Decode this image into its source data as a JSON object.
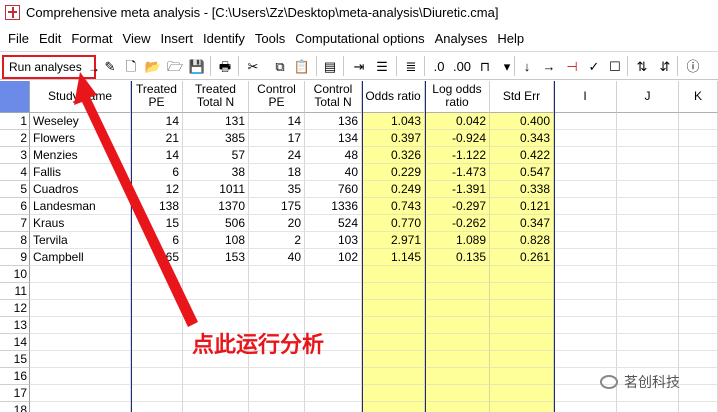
{
  "window": {
    "title": "Comprehensive meta analysis - [C:\\Users\\Zz\\Desktop\\meta-analysis\\Diuretic.cma]"
  },
  "menu": [
    "File",
    "Edit",
    "Format",
    "View",
    "Insert",
    "Identify",
    "Tools",
    "Computational options",
    "Analyses",
    "Help"
  ],
  "toolbar": {
    "run_label": "Run analyses",
    "run_arrow": "→"
  },
  "columns": {
    "study": "Study name",
    "treated_pe": "Treated\nPE",
    "treated_n": "Treated\nTotal N",
    "control_pe": "Control\nPE",
    "control_n": "Control\nTotal N",
    "odds_ratio": "Odds ratio",
    "log_odds": "Log odds\nratio",
    "std_err": "Std Err",
    "col_i": "I",
    "col_j": "J",
    "col_k": "K"
  },
  "rows": [
    {
      "n": "1",
      "study": "Weseley",
      "tpe": "14",
      "tn": "131",
      "cpe": "14",
      "cn": "136",
      "or": "1.043",
      "lor": "0.042",
      "se": "0.400"
    },
    {
      "n": "2",
      "study": "Flowers",
      "tpe": "21",
      "tn": "385",
      "cpe": "17",
      "cn": "134",
      "or": "0.397",
      "lor": "-0.924",
      "se": "0.343"
    },
    {
      "n": "3",
      "study": "Menzies",
      "tpe": "14",
      "tn": "57",
      "cpe": "24",
      "cn": "48",
      "or": "0.326",
      "lor": "-1.122",
      "se": "0.422"
    },
    {
      "n": "4",
      "study": "Fallis",
      "tpe": "6",
      "tn": "38",
      "cpe": "18",
      "cn": "40",
      "or": "0.229",
      "lor": "-1.473",
      "se": "0.547"
    },
    {
      "n": "5",
      "study": "Cuadros",
      "tpe": "12",
      "tn": "1011",
      "cpe": "35",
      "cn": "760",
      "or": "0.249",
      "lor": "-1.391",
      "se": "0.338"
    },
    {
      "n": "6",
      "study": "Landesman",
      "tpe": "138",
      "tn": "1370",
      "cpe": "175",
      "cn": "1336",
      "or": "0.743",
      "lor": "-0.297",
      "se": "0.121"
    },
    {
      "n": "7",
      "study": "Kraus",
      "tpe": "15",
      "tn": "506",
      "cpe": "20",
      "cn": "524",
      "or": "0.770",
      "lor": "-0.262",
      "se": "0.347"
    },
    {
      "n": "8",
      "study": "Tervila",
      "tpe": "6",
      "tn": "108",
      "cpe": "2",
      "cn": "103",
      "or": "2.971",
      "lor": "1.089",
      "se": "0.828"
    },
    {
      "n": "9",
      "study": "Campbell",
      "tpe": "65",
      "tn": "153",
      "cpe": "40",
      "cn": "102",
      "or": "1.145",
      "lor": "0.135",
      "se": "0.261"
    },
    {
      "n": "10"
    },
    {
      "n": "11"
    },
    {
      "n": "12"
    },
    {
      "n": "13"
    },
    {
      "n": "14"
    },
    {
      "n": "15"
    },
    {
      "n": "16"
    },
    {
      "n": "17"
    },
    {
      "n": "18"
    }
  ],
  "annotation": "点此运行分析",
  "watermark": "茗创科技",
  "colors": {
    "highlight": "#e8151b",
    "computed_column": "#ffff99",
    "selection_corner": "#6c8be8"
  }
}
